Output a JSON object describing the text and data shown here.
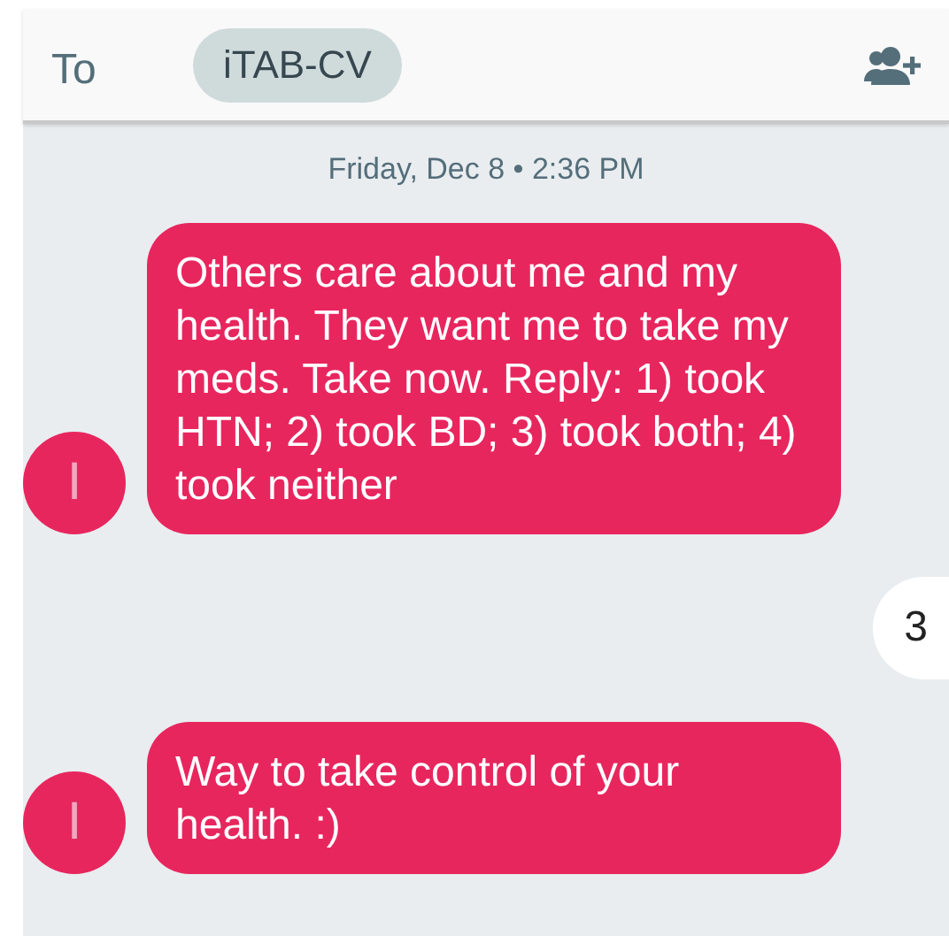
{
  "header": {
    "to_label": "To",
    "recipient": "iTAB-CV"
  },
  "date": "Friday, Dec 8 • 2:36 PM",
  "messages": [
    {
      "kind": "incoming",
      "avatar": "I",
      "text": "Others care about me and my health. They want me to take my meds. Take now. Reply: 1) took HTN; 2) took BD; 3) took both; 4) took neither"
    },
    {
      "kind": "outgoing",
      "text": "3"
    },
    {
      "kind": "incoming",
      "avatar": "I",
      "text": "Way to take control of your health. :)"
    }
  ]
}
